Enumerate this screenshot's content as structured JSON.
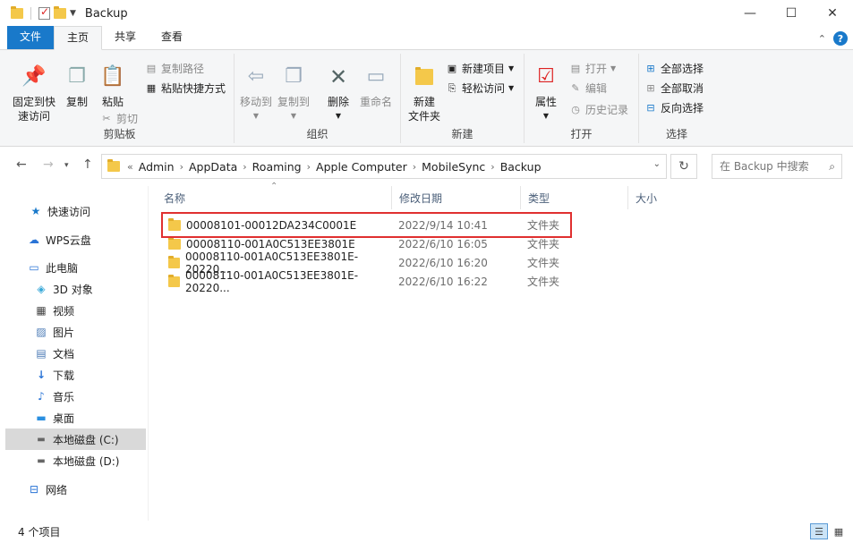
{
  "window": {
    "title": "Backup",
    "minimize_glyph": "—",
    "maximize_glyph": "☐",
    "close_glyph": "✕"
  },
  "tabs": [
    {
      "label": "文件"
    },
    {
      "label": "主页"
    },
    {
      "label": "共享"
    },
    {
      "label": "查看"
    }
  ],
  "ribbon": {
    "clipboard": {
      "label": "剪贴板",
      "pin": "固定到快\n速访问",
      "copy": "复制",
      "paste": "粘贴",
      "copy_path": "复制路径",
      "paste_shortcut": "粘贴快捷方式",
      "cut": "剪切"
    },
    "organize": {
      "label": "组织",
      "move_to": "移动到",
      "copy_to": "复制到",
      "delete": "删除",
      "rename": "重命名"
    },
    "new": {
      "label": "新建",
      "new_folder": "新建\n文件夹",
      "new_item": "新建项目",
      "easy_access": "轻松访问"
    },
    "open": {
      "label": "打开",
      "properties": "属性",
      "open": "打开",
      "edit": "编辑",
      "history": "历史记录"
    },
    "select": {
      "label": "选择",
      "select_all": "全部选择",
      "select_none": "全部取消",
      "invert": "反向选择"
    }
  },
  "address": {
    "prefix": "«",
    "crumbs": [
      "Admin",
      "AppData",
      "Roaming",
      "Apple Computer",
      "MobileSync",
      "Backup"
    ],
    "search_placeholder": "在 Backup 中搜索"
  },
  "nav": {
    "items": [
      {
        "label": "快速访问",
        "icon": "star-icon"
      },
      {
        "label": "WPS云盘",
        "icon": "cloud-icon"
      },
      {
        "label": "此电脑",
        "icon": "computer-icon"
      },
      {
        "label": "3D 对象",
        "icon": "cube-icon"
      },
      {
        "label": "视频",
        "icon": "video-icon"
      },
      {
        "label": "图片",
        "icon": "picture-icon"
      },
      {
        "label": "文档",
        "icon": "document-icon"
      },
      {
        "label": "下载",
        "icon": "download-icon"
      },
      {
        "label": "音乐",
        "icon": "music-icon"
      },
      {
        "label": "桌面",
        "icon": "desktop-icon"
      },
      {
        "label": "本地磁盘 (C:)",
        "icon": "drive-icon"
      },
      {
        "label": "本地磁盘 (D:)",
        "icon": "drive-icon"
      },
      {
        "label": "网络",
        "icon": "network-icon"
      }
    ]
  },
  "columns": {
    "name": "名称",
    "date": "修改日期",
    "type": "类型",
    "size": "大小"
  },
  "files": [
    {
      "name": "00008101-00012DA234C0001E",
      "date": "2022/9/14 10:41",
      "type": "文件夹"
    },
    {
      "name": "00008110-001A0C513EE3801E",
      "date": "2022/6/10 16:05",
      "type": "文件夹"
    },
    {
      "name": "00008110-001A0C513EE3801E-20220...",
      "date": "2022/6/10 16:20",
      "type": "文件夹"
    },
    {
      "name": "00008110-001A0C513EE3801E-20220...",
      "date": "2022/6/10 16:22",
      "type": "文件夹"
    }
  ],
  "status": {
    "count": "4 个项目"
  },
  "colors": {
    "accent": "#1979ca",
    "highlight_box": "#e03030"
  }
}
